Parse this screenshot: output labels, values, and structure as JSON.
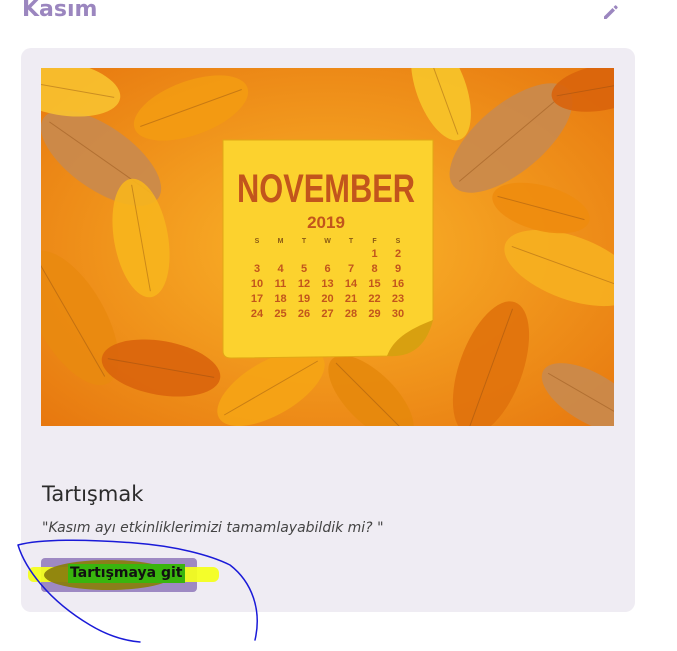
{
  "section": {
    "title": "Kasım",
    "edit_icon": "pencil-icon"
  },
  "card": {
    "image": {
      "month": "NOVEMBER",
      "year": "2019",
      "weekdays": [
        "S",
        "M",
        "T",
        "W",
        "T",
        "F",
        "S"
      ],
      "weeks": [
        [
          "",
          "",
          "",
          "",
          "",
          "1",
          "2"
        ],
        [
          "3",
          "4",
          "5",
          "6",
          "7",
          "8",
          "9"
        ],
        [
          "10",
          "11",
          "12",
          "13",
          "14",
          "15",
          "16"
        ],
        [
          "17",
          "18",
          "19",
          "20",
          "21",
          "22",
          "23"
        ],
        [
          "24",
          "25",
          "26",
          "27",
          "28",
          "29",
          "30"
        ]
      ],
      "colors": {
        "leaf_bg": "#f7a21a",
        "note": "#fcd22e",
        "text": "#c2551c"
      }
    },
    "title": "Tartışmak",
    "quote": "\"Kasım ayı etkinliklerimizi tamamlayabildik mi? \"",
    "button_label": "Tartışmaya git"
  },
  "colors": {
    "accent": "#9b86bf",
    "card_bg": "#efecf3",
    "highlight_yellow": "#f4ff1a",
    "highlight_green": "#39b50e",
    "annotation_blue": "#1a1ad8"
  }
}
